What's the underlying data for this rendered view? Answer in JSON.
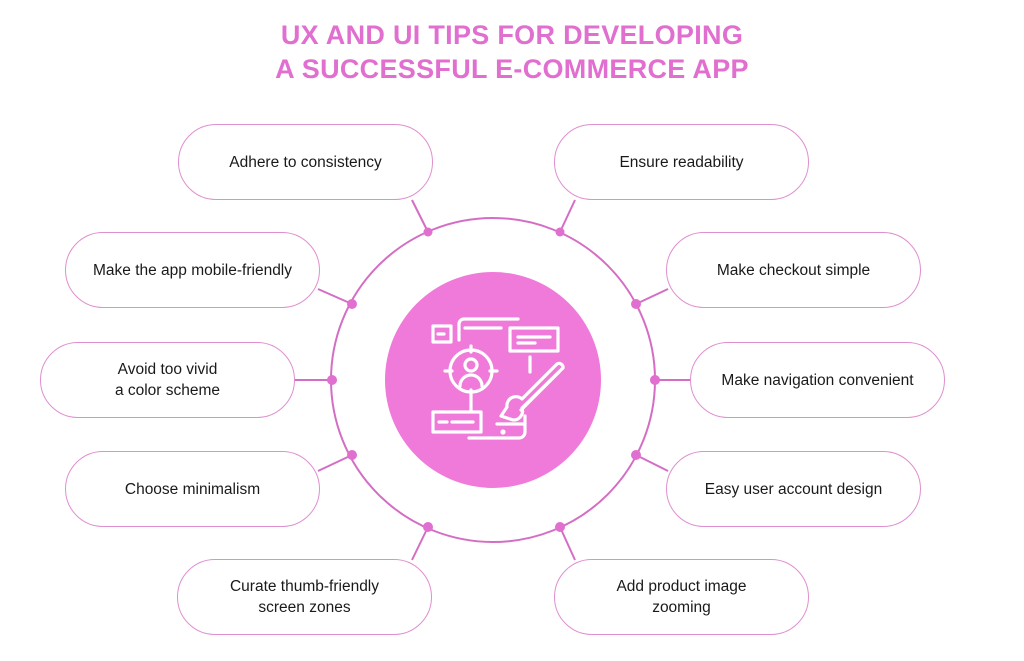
{
  "title": {
    "line1": "UX AND UI TIPS FOR DEVELOPING",
    "line2": "A SUCCESSFUL E-COMMERCE APP"
  },
  "colors": {
    "accent": "#e06fd0",
    "disk": "#f07ad9",
    "ring": "#d46ec4",
    "pill_border": "#df8fcf",
    "text": "#1a1a1a"
  },
  "center_icon": "ui-design-target-user-brush-icon",
  "tips_left": [
    {
      "label": "Adhere to consistency"
    },
    {
      "label": "Make the app mobile-friendly"
    },
    {
      "label": "Avoid too vivid\na color scheme"
    },
    {
      "label": "Choose minimalism"
    },
    {
      "label": "Curate thumb-friendly\nscreen zones"
    }
  ],
  "tips_right": [
    {
      "label": "Ensure readability"
    },
    {
      "label": "Make checkout simple"
    },
    {
      "label": "Make navigation convenient"
    },
    {
      "label": "Easy user account design"
    },
    {
      "label": "Add product image\nzooming"
    }
  ]
}
